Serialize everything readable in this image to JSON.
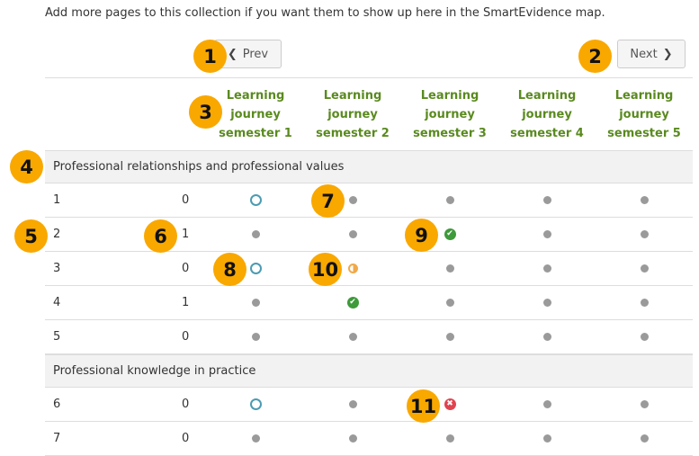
{
  "intro_text": "Add more pages to this collection if you want them to show up here in the SmartEvidence map.",
  "nav": {
    "prev_label": "Prev",
    "next_label": "Next"
  },
  "columns": [
    {
      "l1": "Learning",
      "l2": "journey",
      "l3": "semester 1"
    },
    {
      "l1": "Learning",
      "l2": "journey",
      "l3": "semester 2"
    },
    {
      "l1": "Learning",
      "l2": "journey",
      "l3": "semester 3"
    },
    {
      "l1": "Learning",
      "l2": "journey",
      "l3": "semester 4"
    },
    {
      "l1": "Learning",
      "l2": "journey",
      "l3": "semester 5"
    }
  ],
  "sections": [
    {
      "title": "Professional relationships and professional values",
      "rows": [
        {
          "num": "1",
          "count": "0",
          "status": [
            "empty-ring",
            "dot",
            "dot",
            "dot",
            "dot"
          ]
        },
        {
          "num": "2",
          "count": "1",
          "status": [
            "dot",
            "dot",
            "completed",
            "dot",
            "dot"
          ]
        },
        {
          "num": "3",
          "count": "0",
          "status": [
            "empty-ring",
            "partial",
            "dot",
            "dot",
            "dot"
          ]
        },
        {
          "num": "4",
          "count": "1",
          "status": [
            "dot",
            "completed",
            "dot",
            "dot",
            "dot"
          ]
        },
        {
          "num": "5",
          "count": "0",
          "status": [
            "dot",
            "dot",
            "dot",
            "dot",
            "dot"
          ]
        }
      ]
    },
    {
      "title": "Professional knowledge in practice",
      "rows": [
        {
          "num": "6",
          "count": "0",
          "status": [
            "empty-ring",
            "dot",
            "not-met",
            "dot",
            "dot"
          ]
        },
        {
          "num": "7",
          "count": "0",
          "status": [
            "dot",
            "dot",
            "dot",
            "dot",
            "dot"
          ]
        }
      ]
    }
  ],
  "callouts": [
    "1",
    "2",
    "3",
    "4",
    "5",
    "6",
    "7",
    "8",
    "9",
    "10",
    "11"
  ],
  "colors": {
    "accent_green": "#5a8a1f",
    "callout": "#f9a800",
    "ok": "#3e9a3a",
    "bad": "#e0444f",
    "partial": "#f0a94a",
    "ring": "#4b9bb3"
  }
}
